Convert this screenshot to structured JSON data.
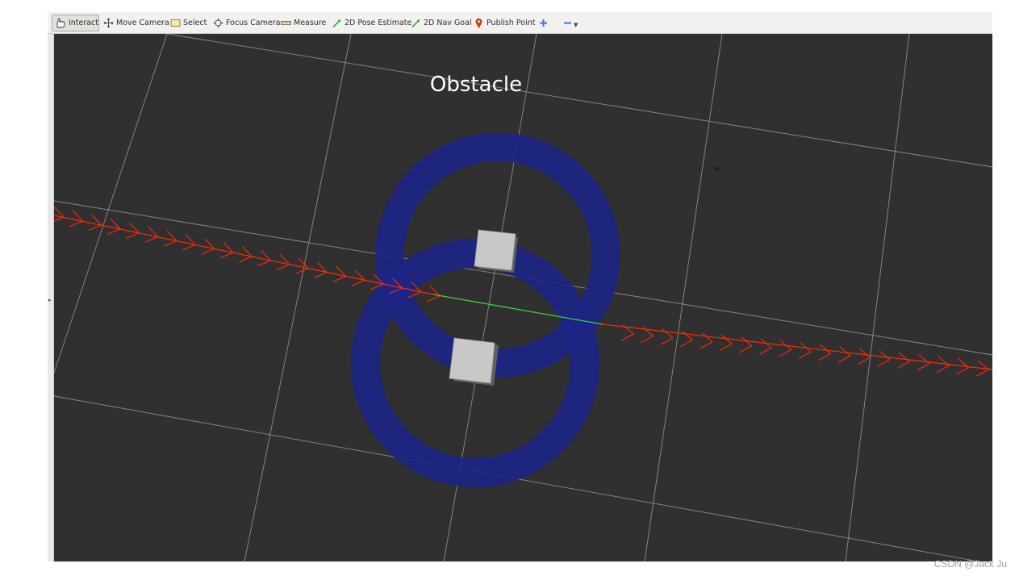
{
  "toolbar": {
    "interact": "Interact",
    "move_camera": "Move Camera",
    "select": "Select",
    "focus_camera": "Focus Camera",
    "measure": "Measure",
    "pose_estimate": "2D Pose Estimate",
    "nav_goal": "2D Nav Goal",
    "publish_point": "Publish Point"
  },
  "icons": {
    "interact": "hand-icon",
    "move_camera": "move-camera-icon",
    "select": "select-box-icon",
    "focus_camera": "crosshair-icon",
    "measure": "ruler-icon",
    "pose_estimate": "green-arrow-icon",
    "nav_goal": "green-arrow-icon",
    "publish_point": "map-pin-icon",
    "add_tool": "plus-icon",
    "remove_tool": "minus-icon"
  },
  "viewport": {
    "marker_label": "Obstacle"
  },
  "colors": {
    "background": "#303030",
    "grid": "#8c8c8c",
    "ring": "#1d2586",
    "box": "#c8c8c8",
    "path_arrows": "#ff2b00",
    "plan_line": "#3cd23c"
  },
  "watermark": "CSDN @Jack Ju"
}
